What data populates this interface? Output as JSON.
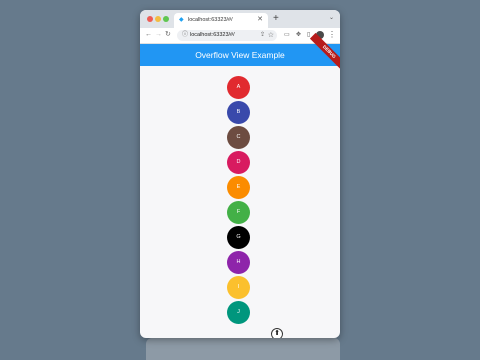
{
  "browser": {
    "tab_title": "localhost:63323/#/",
    "url": "localhost:63323/#/",
    "new_tab_symbol": "+",
    "tab_close_symbol": "✕"
  },
  "app": {
    "title": "Overflow View Example",
    "debug_banner": "DEBUG"
  },
  "circles": [
    {
      "label": "A",
      "color": "#e12a2f"
    },
    {
      "label": "B",
      "color": "#3949ab"
    },
    {
      "label": "C",
      "color": "#6d4c41"
    },
    {
      "label": "D",
      "color": "#d81b60"
    },
    {
      "label": "E",
      "color": "#fb8c00"
    },
    {
      "label": "F",
      "color": "#43b047"
    },
    {
      "label": "G",
      "color": "#000000"
    },
    {
      "label": "H",
      "color": "#8e24aa"
    },
    {
      "label": "I",
      "color": "#fbc02d"
    },
    {
      "label": "J",
      "color": "#00967d"
    }
  ],
  "scroll_button_icon": "up-arrow-icon"
}
